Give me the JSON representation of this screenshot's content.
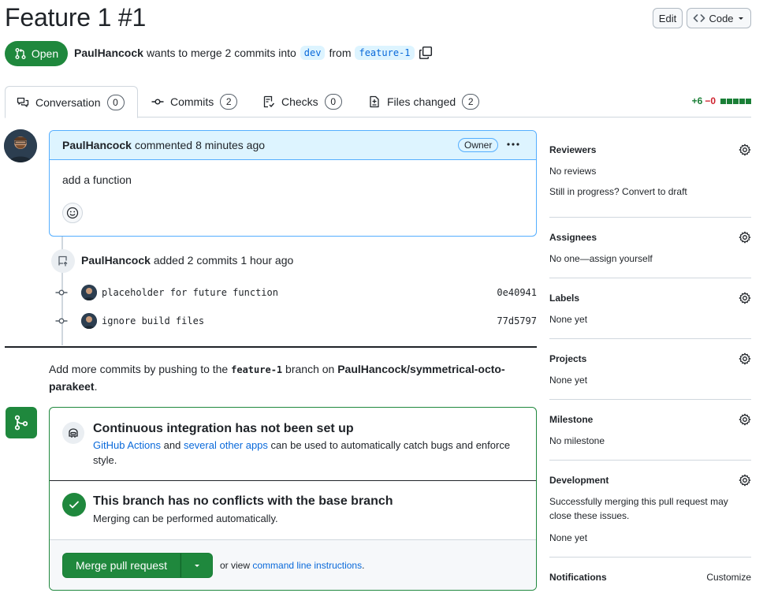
{
  "pr": {
    "title": "Feature 1 #1",
    "state": "Open",
    "author": "PaulHancock",
    "merge_text": "wants to merge 2 commits into",
    "base_branch": "dev",
    "from_text": "from",
    "head_branch": "feature-1"
  },
  "header": {
    "edit_label": "Edit",
    "code_label": "Code"
  },
  "tabs": [
    {
      "label": "Conversation",
      "count": "0"
    },
    {
      "label": "Commits",
      "count": "2"
    },
    {
      "label": "Checks",
      "count": "0"
    },
    {
      "label": "Files changed",
      "count": "2"
    }
  ],
  "diffstat": {
    "additions": "+6",
    "deletions": "−0"
  },
  "comment": {
    "author": "PaulHancock",
    "action": "commented",
    "time": "8 minutes ago",
    "badge": "Owner",
    "body": "add a function"
  },
  "timeline": {
    "author": "PaulHancock",
    "action": "added 2 commits",
    "time": "1 hour ago",
    "commits": [
      {
        "message": "placeholder for future function",
        "sha": "0e40941"
      },
      {
        "message": "ignore build files",
        "sha": "77d5797"
      }
    ]
  },
  "push_hint": {
    "prefix": "Add more commits by pushing to the",
    "branch": "feature-1",
    "middle": "branch on",
    "repo": "PaulHancock/symmetrical-octo-parakeet",
    "suffix": "."
  },
  "merge": {
    "ci_title": "Continuous integration has not been set up",
    "ci_link1": "GitHub Actions",
    "ci_and": "and",
    "ci_link2": "several other apps",
    "ci_rest": "can be used to automatically catch bugs and enforce style.",
    "conflict_title": "This branch has no conflicts with the base branch",
    "conflict_desc": "Merging can be performed automatically.",
    "merge_button": "Merge pull request",
    "alt_prefix": "or view",
    "alt_link": "command line instructions",
    "alt_suffix": "."
  },
  "sidebar": {
    "reviewers": {
      "title": "Reviewers",
      "value": "No reviews",
      "extra": "Still in progress? Convert to draft"
    },
    "assignees": {
      "title": "Assignees",
      "value": "No one—assign yourself"
    },
    "labels": {
      "title": "Labels",
      "value": "None yet"
    },
    "projects": {
      "title": "Projects",
      "value": "None yet"
    },
    "milestone": {
      "title": "Milestone",
      "value": "No milestone"
    },
    "development": {
      "title": "Development",
      "desc": "Successfully merging this pull request may close these issues.",
      "value": "None yet"
    },
    "notifications": {
      "title": "Notifications",
      "action": "Customize"
    }
  },
  "colors": {
    "accent": "#0969da",
    "success": "#1f883d",
    "comment_border": "#54aeff",
    "comment_bg": "#ddf4ff"
  }
}
